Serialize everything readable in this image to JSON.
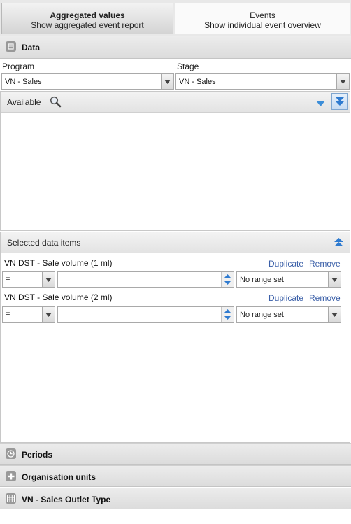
{
  "tabs": [
    {
      "title": "Aggregated values",
      "subtitle": "Show aggregated event report"
    },
    {
      "title": "Events",
      "subtitle": "Show individual event overview"
    }
  ],
  "data_section": {
    "title": "Data",
    "icon": "data-icon"
  },
  "program": {
    "label": "Program",
    "value": "VN - Sales"
  },
  "stage": {
    "label": "Stage",
    "value": "VN - Sales"
  },
  "available": {
    "label": "Available",
    "search_icon": "search-icon"
  },
  "selected": {
    "label": "Selected data items",
    "items": [
      {
        "title": "VN DST - Sale volume (1 ml)",
        "operator": "=",
        "value": "",
        "range": "No range set",
        "duplicate": "Duplicate",
        "remove": "Remove"
      },
      {
        "title": "VN DST - Sale volume (2 ml)",
        "operator": "=",
        "value": "",
        "range": "No range set",
        "duplicate": "Duplicate",
        "remove": "Remove"
      }
    ]
  },
  "sections": [
    {
      "title": "Periods",
      "icon": "clock-icon"
    },
    {
      "title": "Organisation units",
      "icon": "plus-icon"
    },
    {
      "title": "VN - Sales Outlet Type",
      "icon": "grid-icon"
    }
  ],
  "colors": {
    "link": "#3a5fa8",
    "accent_blue": "#3d8ed8"
  }
}
